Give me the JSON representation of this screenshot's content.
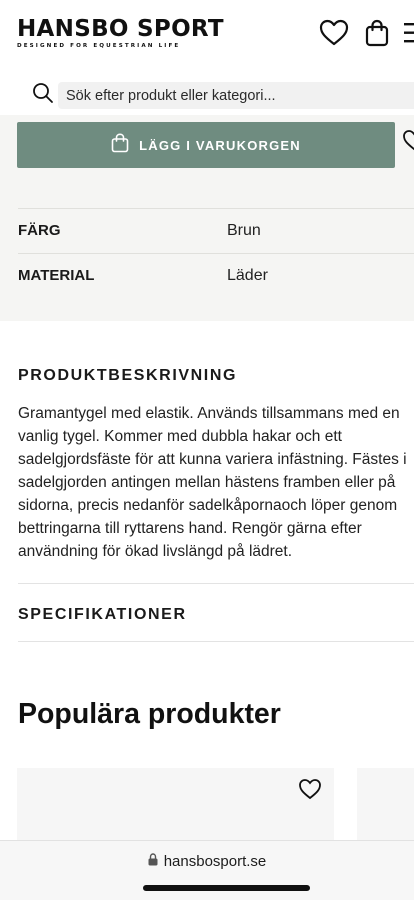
{
  "header": {
    "logo": "HANSBO SPORT",
    "tagline": "DESIGNED FOR EQUESTRIAN LIFE"
  },
  "search": {
    "placeholder": "Sök efter produkt eller kategori..."
  },
  "product": {
    "add_to_cart_label": "LÄGG I VARUKORGEN",
    "attributes": [
      {
        "key": "FÄRG",
        "value": "Brun"
      },
      {
        "key": "MATERIAL",
        "value": "Läder"
      }
    ]
  },
  "description": {
    "title": "PRODUKTBESKRIVNING",
    "text": "Gramantygel med elastik. Används tillsammans med en vanlig tygel. Kommer med dubbla hakar och ett sadelgjordsfäste för att kunna variera infästning. Fästes i sadelgjorden antingen mellan hästens framben eller på sidorna, precis nedanför sadelkåpornaoch löper genom bettringarna till ryttarens hand. Rengör gärna efter användning för ökad livslängd på lädret."
  },
  "specifications": {
    "title": "SPECIFIKATIONER"
  },
  "popular": {
    "title": "Populära produkter"
  },
  "browser": {
    "url": "hansbosport.se"
  },
  "colors": {
    "accent": "#6f8c80",
    "gray_bg": "#f5f5f3"
  }
}
